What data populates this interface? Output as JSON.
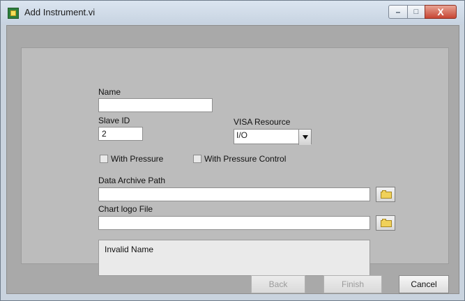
{
  "window": {
    "title": "Add Instrument.vi",
    "controls": {
      "minimize": "–",
      "maximize": "□",
      "close": "X"
    }
  },
  "form": {
    "name": {
      "label": "Name",
      "value": ""
    },
    "slave_id": {
      "label": "Slave ID",
      "value": "2"
    },
    "visa_resource": {
      "label": "VISA Resource",
      "icon_glyph": "I/O",
      "value": ""
    },
    "with_pressure": {
      "label": "With Pressure",
      "checked": false
    },
    "with_pressure_control": {
      "label": "With Pressure Control",
      "checked": false
    },
    "data_archive_path": {
      "label": "Data Archive Path",
      "value": ""
    },
    "chart_logo_file": {
      "label": "Chart logo File",
      "value": ""
    },
    "status_message": "Invalid Name"
  },
  "buttons": {
    "back": "Back",
    "finish": "Finish",
    "cancel": "Cancel"
  },
  "icons": {
    "app": "labview-vi-icon",
    "browse": "folder-icon",
    "dropdown_arrow": "chevron-down-icon"
  }
}
